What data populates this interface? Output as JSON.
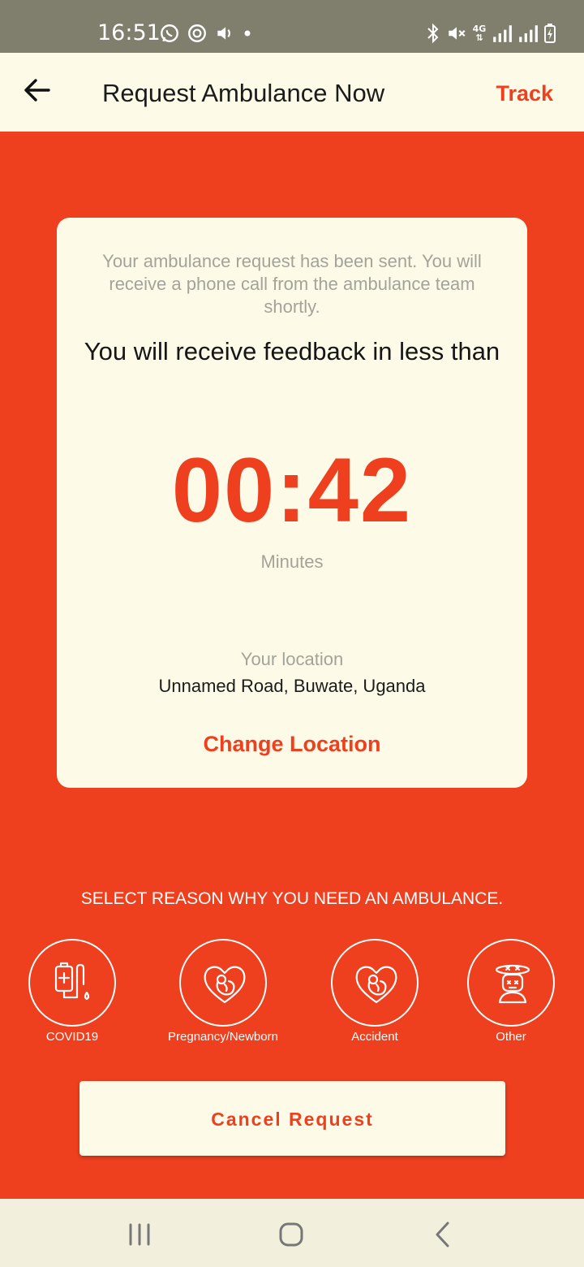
{
  "status_bar": {
    "time": "16:51",
    "network": "4G",
    "icons_left": [
      "whatsapp-icon",
      "sync-icon",
      "volume-icon",
      "dot-icon"
    ],
    "icons_right": [
      "bluetooth-icon",
      "mute-icon",
      "network-4g-icon",
      "signal-icon",
      "signal-icon",
      "battery-charging-icon"
    ]
  },
  "app_bar": {
    "title": "Request Ambulance Now",
    "track_label": "Track",
    "back_icon": "arrow-left-icon"
  },
  "card": {
    "message": "Your ambulance request has been sent. You will receive a phone call from the ambulance team shortly.",
    "feedback": "You will receive feedback in less than",
    "countdown": "00:42",
    "unit": "Minutes",
    "location_label": "Your location",
    "location_value": "Unnamed Road,  Buwate,  Uganda",
    "change_location": "Change Location"
  },
  "reasons": {
    "heading": "SELECT REASON WHY YOU NEED AN AMBULANCE.",
    "items": [
      {
        "label": "COVID19",
        "icon": "iv-drip-icon"
      },
      {
        "label": "Pregnancy/Newborn",
        "icon": "fetus-heart-icon"
      },
      {
        "label": "Accident",
        "icon": "fetus-heart-icon"
      },
      {
        "label": "Other",
        "icon": "dizzy-person-icon"
      }
    ]
  },
  "cancel_label": "Cancel Request",
  "colors": {
    "accent": "#EE3F1E",
    "card_bg": "#FDFBE7",
    "status_bar": "#807E6C",
    "muted_text": "#A4A39A"
  },
  "nav_bar": {
    "icons": [
      "recents-icon",
      "home-icon",
      "back-icon"
    ]
  }
}
